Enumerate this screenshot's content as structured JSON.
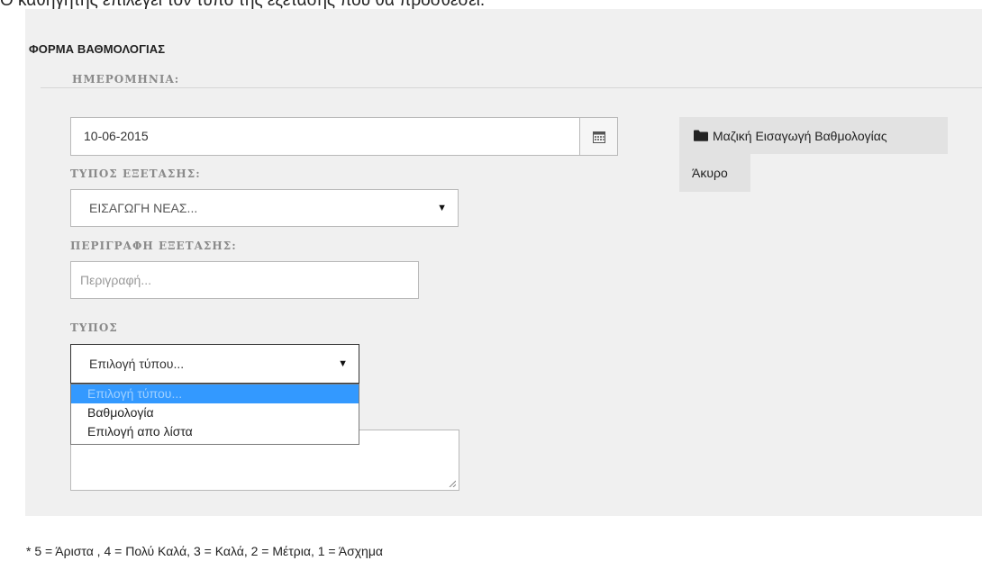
{
  "caption": "Ο καθηγητής επιλέγει τον τύπο της εξέτασης που θα προσθέσει.",
  "form": {
    "title": "ΦΟΡΜΑ ΒΑΘΜΟΛΟΓΙΑΣ",
    "date_label": "ΗΜΕΡΟΜΗΝΙΑ:",
    "date_value": "10-06-2015",
    "exam_type_label": "ΤΥΠΟΣ ΕΞΕΤΑΣΗΣ:",
    "exam_type_value": "ΕΙΣΑΓΩΓΗ ΝΕΑΣ...",
    "description_label": "ΠΕΡΙΓΡΑΦΗ ΕΞΕΤΑΣΗΣ:",
    "description_placeholder": "Περιγραφή...",
    "type_label": "ΤΥΠΟΣ",
    "type_value": "Επιλογή τύπου...",
    "type_options": [
      "Επιλογή τύπου...",
      "Βαθμολογία",
      "Επιλογή απο λίστα"
    ],
    "type_highlighted_index": 0
  },
  "buttons": {
    "bulk_import": "Μαζική Εισαγωγή Βαθμολογίας",
    "cancel": "Άκυρο"
  },
  "footnote": "* 5 = Άριστα , 4 = Πολύ Καλά, 3 = Καλά, 2 = Μέτρια, 1 = Άσχημα",
  "colors": {
    "panel_bg": "#f0f0f0",
    "option_highlight": "#3399ff",
    "button_bg": "#e2e2e2"
  },
  "icons": {
    "calendar": "calendar-icon",
    "folder": "folder-icon"
  }
}
